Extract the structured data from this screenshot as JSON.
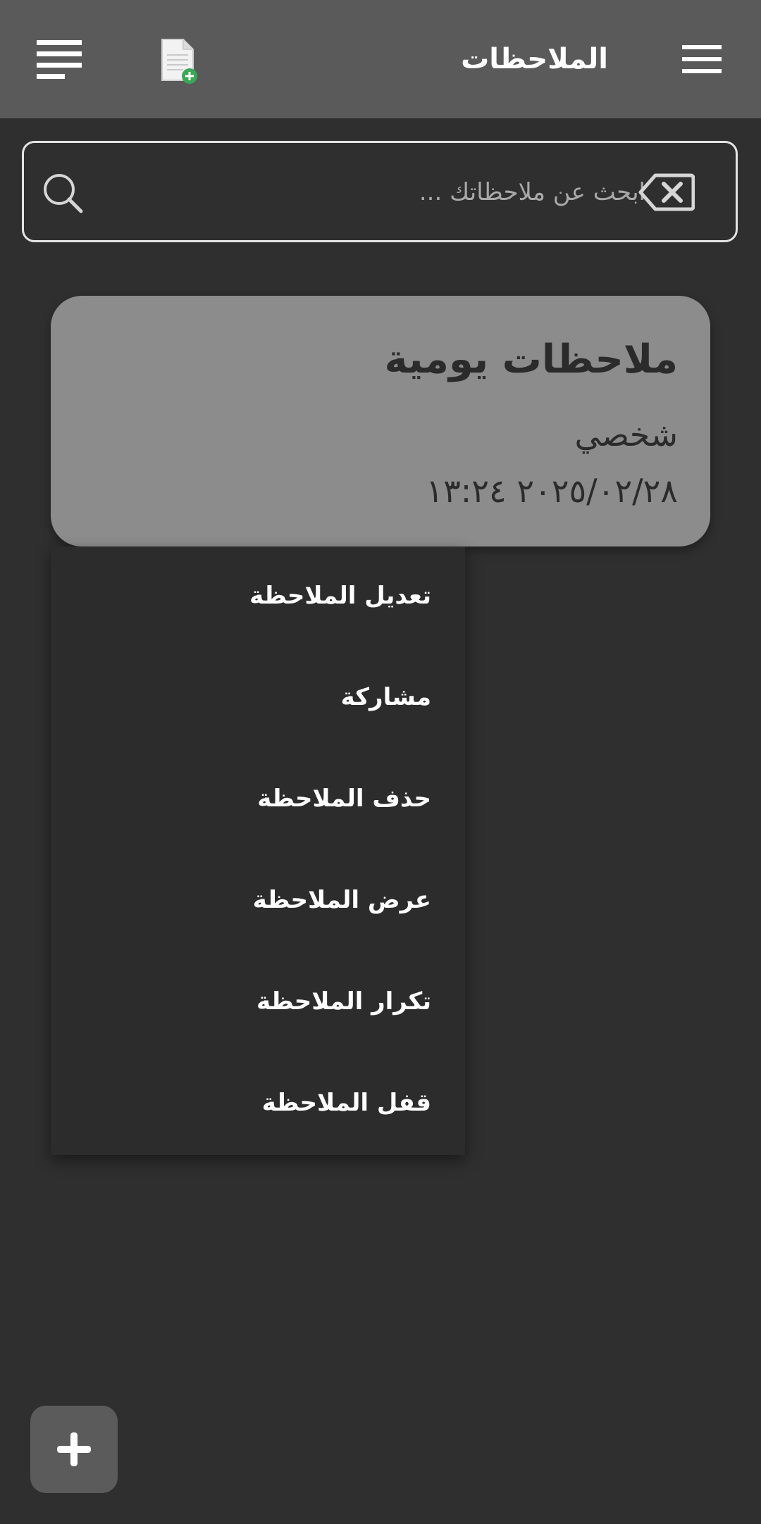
{
  "appbar": {
    "title": "الملاحظات",
    "background": "#5a5a5a",
    "icons": [
      "menu-icon",
      "new-note-icon",
      "sort-icon"
    ]
  },
  "search": {
    "placeholder": "ابحث عن ملاحظاتك ...",
    "value": "",
    "icons": [
      "search-icon",
      "clear-input-icon"
    ]
  },
  "note": {
    "title": "ملاحظات يومية",
    "category": "شخصي",
    "datetime": "٢٠٢٥/٠٢/٢٨ ١٣:٢٤",
    "background": "#8c8c8c"
  },
  "context_menu": {
    "items": [
      {
        "label": "تعديل الملاحظة"
      },
      {
        "label": "مشاركة"
      },
      {
        "label": "حذف الملاحظة"
      },
      {
        "label": "عرض الملاحظة"
      },
      {
        "label": "تكرار الملاحظة"
      },
      {
        "label": "قفل الملاحظة"
      }
    ]
  },
  "fab": {
    "icon": "plus-icon",
    "background": "#5b5b5b"
  }
}
